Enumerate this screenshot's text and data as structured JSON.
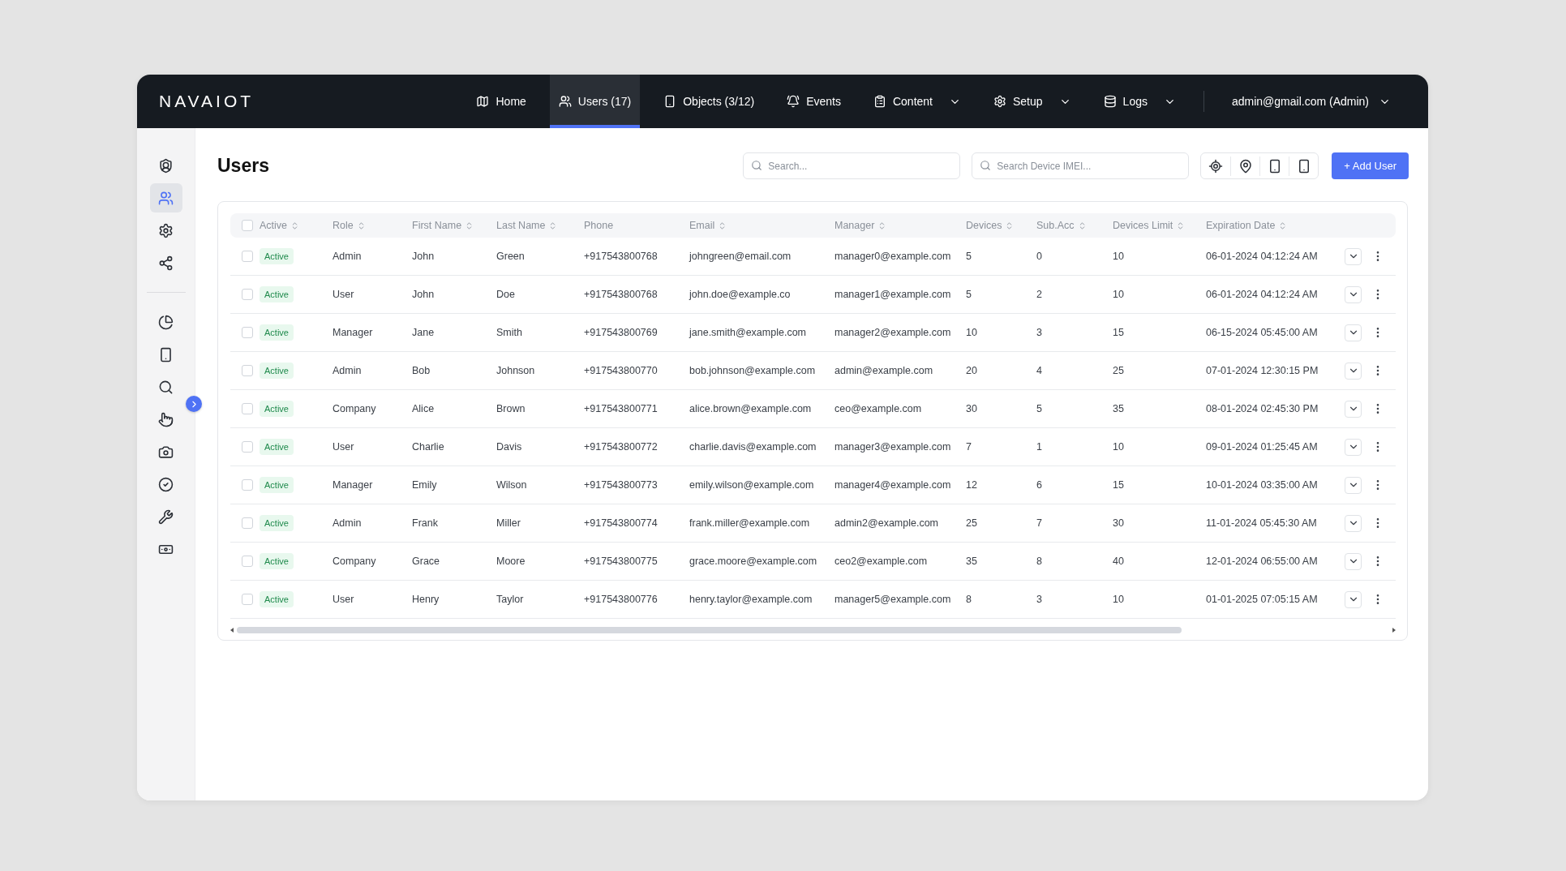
{
  "navbar": {
    "logo": "NAVAIOT",
    "items": [
      {
        "label": "Home",
        "selected": false,
        "dropdown": false
      },
      {
        "label": "Users (17)",
        "selected": true,
        "dropdown": false
      },
      {
        "label": "Objects (3/12)",
        "selected": false,
        "dropdown": false
      },
      {
        "label": "Events",
        "selected": false,
        "dropdown": false
      },
      {
        "label": "Content",
        "selected": false,
        "dropdown": true
      },
      {
        "label": "Setup",
        "selected": false,
        "dropdown": true
      },
      {
        "label": "Logs",
        "selected": false,
        "dropdown": true
      }
    ],
    "account": "admin@gmail.com (Admin)"
  },
  "sidebar": {
    "groups": [
      [
        {
          "selected": false
        },
        {
          "selected": true
        },
        {
          "selected": false
        },
        {
          "selected": false
        }
      ],
      [
        {
          "selected": false
        },
        {
          "selected": false
        },
        {
          "selected": false
        },
        {
          "selected": false
        },
        {
          "selected": false
        },
        {
          "selected": false
        },
        {
          "selected": false
        },
        {
          "selected": false
        }
      ]
    ]
  },
  "page": {
    "title": "Users",
    "search": {
      "placeholder": "Search..."
    },
    "imei_search": {
      "placeholder": "Search Device IMEI..."
    },
    "add_button": "+ Add User"
  },
  "table": {
    "columns": [
      {
        "label": "Active",
        "sortable": true
      },
      {
        "label": "Role",
        "sortable": true
      },
      {
        "label": "First Name",
        "sortable": true
      },
      {
        "label": "Last Name",
        "sortable": true
      },
      {
        "label": "Phone",
        "sortable": false
      },
      {
        "label": "Email",
        "sortable": true
      },
      {
        "label": "Manager",
        "sortable": true
      },
      {
        "label": "Devices",
        "sortable": true
      },
      {
        "label": "Sub.Acc",
        "sortable": true
      },
      {
        "label": "Devices Limit",
        "sortable": true
      },
      {
        "label": "Expiration Date",
        "sortable": true
      }
    ],
    "header_checked": false,
    "rows": [
      {
        "checked": false,
        "cells": [
          "Active",
          "Admin",
          "John",
          "Green",
          "+917543800768",
          "johngreen@email.com",
          "manager0@example.com",
          "5",
          "0",
          "10",
          "06-01-2024 04:12:24 AM"
        ]
      },
      {
        "checked": false,
        "cells": [
          "Active",
          "User",
          "John",
          "Doe",
          "+917543800768",
          "john.doe@example.co",
          "manager1@example.com",
          "5",
          "2",
          "10",
          "06-01-2024 04:12:24 AM"
        ]
      },
      {
        "checked": false,
        "cells": [
          "Active",
          "Manager",
          "Jane",
          "Smith",
          "+917543800769",
          "jane.smith@example.com",
          "manager2@example.com",
          "10",
          "3",
          "15",
          "06-15-2024 05:45:00 AM"
        ]
      },
      {
        "checked": false,
        "cells": [
          "Active",
          "Admin",
          "Bob",
          "Johnson",
          "+917543800770",
          "bob.johnson@example.com",
          "admin@example.com",
          "20",
          "4",
          "25",
          "07-01-2024 12:30:15 PM"
        ]
      },
      {
        "checked": false,
        "cells": [
          "Active",
          "Company",
          "Alice",
          "Brown",
          "+917543800771",
          "alice.brown@example.com",
          "ceo@example.com",
          "30",
          "5",
          "35",
          "08-01-2024 02:45:30 PM"
        ]
      },
      {
        "checked": false,
        "cells": [
          "Active",
          "User",
          "Charlie",
          "Davis",
          "+917543800772",
          "charlie.davis@example.com",
          "manager3@example.com",
          "7",
          "1",
          "10",
          "09-01-2024 01:25:45 AM"
        ]
      },
      {
        "checked": false,
        "cells": [
          "Active",
          "Manager",
          "Emily",
          "Wilson",
          "+917543800773",
          "emily.wilson@example.com",
          "manager4@example.com",
          "12",
          "6",
          "15",
          "10-01-2024 03:35:00 AM"
        ]
      },
      {
        "checked": false,
        "cells": [
          "Active",
          "Admin",
          "Frank",
          "Miller",
          "+917543800774",
          "frank.miller@example.com",
          "admin2@example.com",
          "25",
          "7",
          "30",
          "11-01-2024 05:45:30 AM"
        ]
      },
      {
        "checked": false,
        "cells": [
          "Active",
          "Company",
          "Grace",
          "Moore",
          "+917543800775",
          "grace.moore@example.com",
          "ceo2@example.com",
          "35",
          "8",
          "40",
          "12-01-2024 06:55:00 AM"
        ]
      },
      {
        "checked": false,
        "cells": [
          "Active",
          "User",
          "Henry",
          "Taylor",
          "+917543800776",
          "henry.taylor@example.com",
          "manager5@example.com",
          "8",
          "3",
          "10",
          "01-01-2025 07:05:15 AM"
        ]
      }
    ]
  }
}
